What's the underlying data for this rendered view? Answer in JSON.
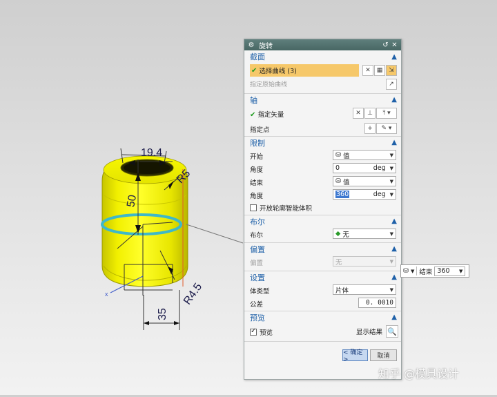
{
  "dialog": {
    "title": "旋转",
    "title_buttons": [
      "↺",
      "✕"
    ],
    "sections": {
      "section_curve": {
        "label": "截面",
        "selected_label": "选择曲线 (3)",
        "origin_label": "指定原始曲线"
      },
      "axis": {
        "label": "轴",
        "vector_label": "指定矢量",
        "point_label": "指定点"
      },
      "limits": {
        "label": "限制",
        "start_label": "开始",
        "start_value": "值",
        "start_angle_label": "角度",
        "start_angle_value": "0",
        "end_label": "结束",
        "end_value": "值",
        "end_angle_label": "角度",
        "end_angle_value": "360",
        "unit": "deg",
        "open_profile_label": "开放轮廓智能体积"
      },
      "boolean": {
        "label": "布尔",
        "field_label": "布尔",
        "field_value": "无"
      },
      "offset": {
        "label": "偏置",
        "field_label": "偏置",
        "field_value": "无"
      },
      "settings": {
        "label": "设置",
        "body_type_label": "体类型",
        "body_type_value": "片体",
        "tolerance_label": "公差",
        "tolerance_value": "0. 0010"
      },
      "preview": {
        "label": "预览",
        "preview_check_label": "预览",
        "show_result_label": "显示结果"
      }
    },
    "ok_label": "< 确定 >",
    "cancel_label": "取消"
  },
  "float_toolbar": {
    "end_label": "结束",
    "end_value": "360"
  },
  "model": {
    "dimensions": [
      "19.4",
      "R5",
      "50",
      "R4.5",
      "35"
    ],
    "axis_label": "x"
  },
  "watermark": "知乎 @模具设计"
}
